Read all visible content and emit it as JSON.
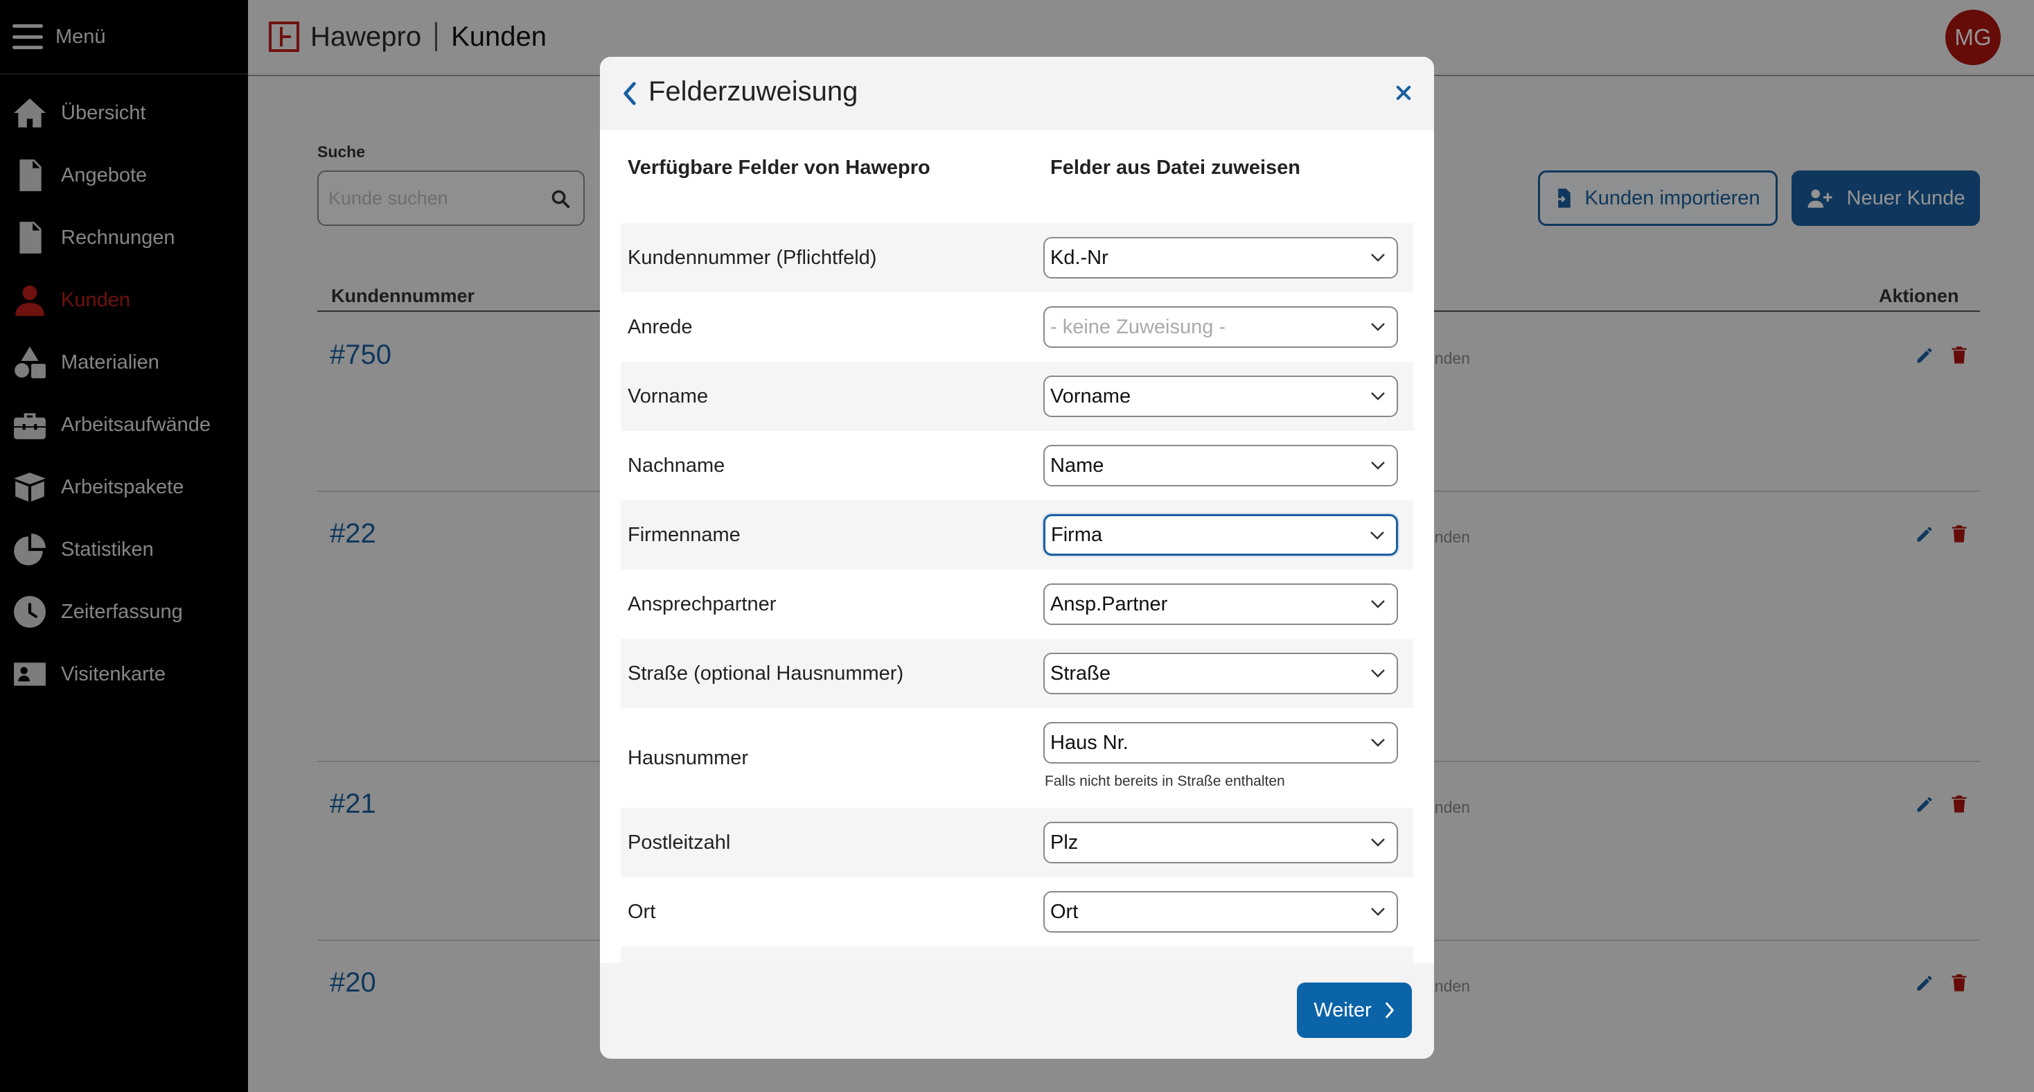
{
  "sidebar": {
    "menu_label": "Menü",
    "items": [
      {
        "label": "Übersicht",
        "icon": "home-icon"
      },
      {
        "label": "Angebote",
        "icon": "document-icon"
      },
      {
        "label": "Rechnungen",
        "icon": "invoice-icon"
      },
      {
        "label": "Kunden",
        "icon": "user-icon",
        "active": true
      },
      {
        "label": "Materialien",
        "icon": "shapes-icon"
      },
      {
        "label": "Arbeitsaufwände",
        "icon": "toolbox-icon"
      },
      {
        "label": "Arbeitspakete",
        "icon": "box-icon"
      },
      {
        "label": "Statistiken",
        "icon": "pie-chart-icon"
      },
      {
        "label": "Zeiterfassung",
        "icon": "clock-icon"
      },
      {
        "label": "Visitenkarte",
        "icon": "id-card-icon"
      }
    ]
  },
  "header": {
    "brand": "Hawepro",
    "page_title": "Kunden",
    "avatar_initials": "MG"
  },
  "main": {
    "search_label": "Suche",
    "search_placeholder": "Kunde suchen",
    "import_button": "Kunden importieren",
    "new_button": "Neuer Kunde",
    "col_number": "Kundennummer",
    "col_actions": "Aktionen",
    "rows": [
      {
        "number": "#750",
        "status": "anden"
      },
      {
        "number": "#22",
        "status": "anden"
      },
      {
        "number": "#21",
        "status": "anden"
      },
      {
        "number": "#20",
        "status": "anden"
      }
    ]
  },
  "modal": {
    "title": "Felderzuweisung",
    "col_available": "Verfügbare Felder von Hawepro",
    "col_assign": "Felder aus Datei zuweisen",
    "rows": [
      {
        "label": "Kundennummer (Pflichtfeld)",
        "value": "Kd.-Nr"
      },
      {
        "label": "Anrede",
        "value": "- keine Zuweisung -"
      },
      {
        "label": "Vorname",
        "value": "Vorname"
      },
      {
        "label": "Nachname",
        "value": "Name"
      },
      {
        "label": "Firmenname",
        "value": "Firma"
      },
      {
        "label": "Ansprechpartner",
        "value": "Ansp.Partner"
      },
      {
        "label": "Straße (optional Hausnummer)",
        "value": "Straße"
      },
      {
        "label": "Hausnummer",
        "value": "Haus Nr.",
        "hint": "Falls nicht bereits in Straße enthalten"
      },
      {
        "label": "Postleitzahl",
        "value": "Plz"
      },
      {
        "label": "Ort",
        "value": "Ort"
      }
    ],
    "next_button": "Weiter"
  },
  "colors": {
    "accent_blue": "#1a5fa0",
    "brand_red": "#c0201b",
    "sidebar_bg": "#000000"
  }
}
